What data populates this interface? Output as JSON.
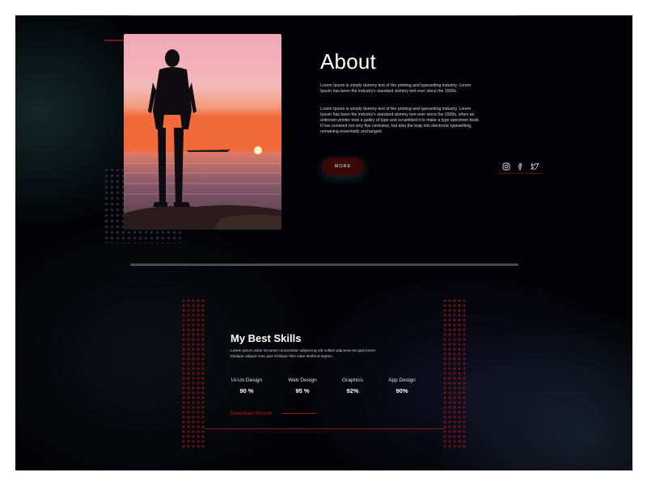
{
  "about": {
    "title": "About",
    "paragraph1": "Lorem Ipsum is simply dummy text of the printing and typesetting industry. Lorem Ipsum has been the industry's standard dummy text ever since the 1500s.",
    "paragraph2": "Lorem Ipsum is simply dummy text of the printing and typesetting industry. Lorem Ipsum has been the industry's standard dummy text ever since the 1500s, when an unknown printer took a galley of type and scrambled it to make a type specimen book. It has survived not only five centuries, but also the leap into electronic typesetting, remaining essentially unchanged.",
    "more_label": "MORE"
  },
  "social": [
    "instagram-icon",
    "facebook-icon",
    "twitter-icon"
  ],
  "skills": {
    "title": "My Best Skills",
    "description": "Lorem ipsum dolor sit amet consectetur adipiscing elit nullam placerat est quis lorem tristique aliquet cras quis tristique felis vitae eleifend sapien.",
    "items": [
      {
        "name": "Ui-Ux Design",
        "value": "90 %"
      },
      {
        "name": "Web Design",
        "value": "95 %"
      },
      {
        "name": "Graphics",
        "value": "92%"
      },
      {
        "name": "App Design",
        "value": "90%"
      }
    ],
    "download_label": "Download Resum"
  },
  "colors": {
    "background": "#030306",
    "accent_red": "#8a1616",
    "button_bg": "#3a0606",
    "text": "#ffffff"
  }
}
